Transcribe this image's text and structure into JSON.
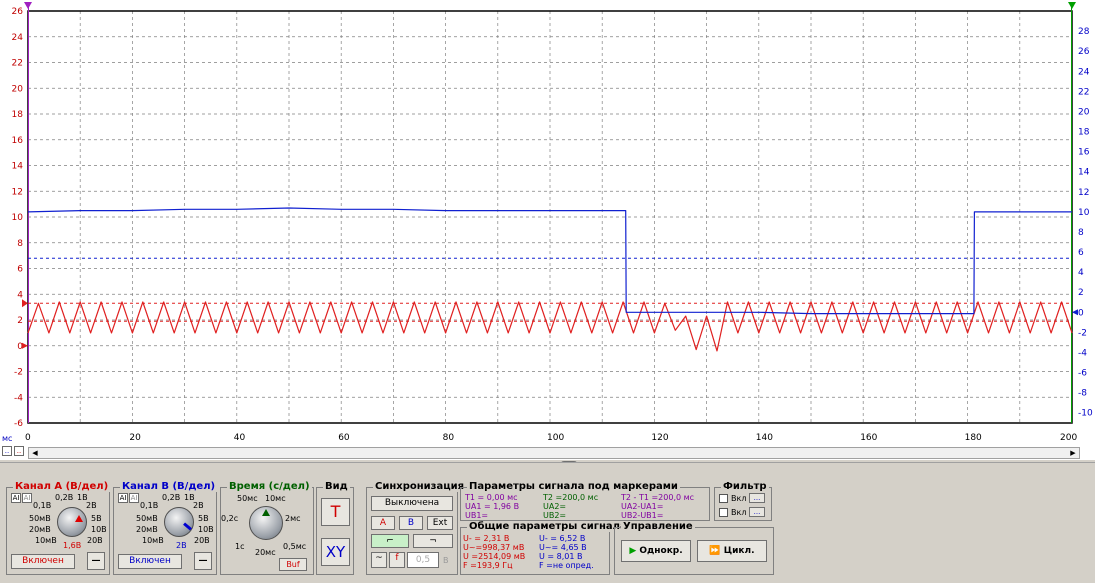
{
  "plot": {
    "y_left_ticks": [
      "26",
      "24",
      "22",
      "20",
      "18",
      "16",
      "14",
      "12",
      "10",
      "8",
      "6",
      "4",
      "2",
      "0",
      "-2",
      "-4",
      "-6"
    ],
    "y_right_ticks": [
      "28",
      "26",
      "24",
      "22",
      "20",
      "18",
      "16",
      "14",
      "12",
      "10",
      "8",
      "6",
      "4",
      "2",
      "0",
      "-2",
      "-4",
      "-6",
      "-8",
      "-10"
    ],
    "x_ticks": [
      "0",
      "20",
      "40",
      "60",
      "80",
      "100",
      "120",
      "140",
      "160",
      "180",
      "200"
    ],
    "x_unit": "мс",
    "colors": {
      "channel_a": "#e02020",
      "channel_b": "#1020d0",
      "grid": "#808080"
    }
  },
  "chart_data": {
    "type": "line",
    "xlim": [
      0,
      200
    ],
    "ylim": [
      -6,
      26
    ],
    "grid": true,
    "series": [
      {
        "name": "Канал A",
        "color": "#e02020",
        "x": [
          0,
          2,
          4,
          6,
          8,
          10,
          12,
          14,
          16,
          18,
          20,
          22,
          24,
          26,
          28,
          30,
          32,
          34,
          36,
          38,
          40,
          42,
          44,
          46,
          48,
          50,
          52,
          54,
          56,
          58,
          60,
          62,
          64,
          66,
          68,
          70,
          72,
          74,
          76,
          78,
          80,
          82,
          84,
          86,
          88,
          90,
          92,
          94,
          96,
          98,
          100,
          102,
          104,
          106,
          108,
          110,
          112,
          114,
          116,
          118,
          120,
          122,
          124,
          126,
          128,
          130,
          132,
          134,
          136,
          138,
          140,
          142,
          144,
          146,
          148,
          150,
          152,
          154,
          156,
          158,
          160,
          162,
          164,
          166,
          168,
          170,
          172,
          174,
          176,
          178,
          180,
          182,
          184,
          186,
          188,
          190,
          192,
          194,
          196,
          198,
          200
        ],
        "y": [
          1.0,
          3.3,
          1.0,
          3.4,
          1.0,
          3.4,
          1.0,
          3.4,
          1.0,
          3.4,
          1.0,
          3.4,
          1.0,
          3.4,
          1.0,
          3.4,
          1.0,
          3.4,
          1.0,
          3.4,
          1.0,
          3.4,
          1.0,
          3.4,
          1.0,
          3.4,
          1.0,
          3.4,
          1.0,
          3.4,
          1.0,
          3.4,
          1.0,
          3.4,
          1.0,
          3.4,
          1.0,
          3.4,
          1.0,
          3.4,
          1.0,
          3.4,
          1.0,
          3.4,
          1.0,
          3.4,
          1.0,
          3.4,
          1.0,
          3.4,
          1.0,
          3.4,
          1.0,
          3.4,
          1.0,
          3.4,
          1.0,
          3.4,
          1.0,
          3.4,
          1.0,
          3.3,
          1.2,
          2.3,
          -0.3,
          2.3,
          -0.4,
          3.4,
          1.0,
          3.4,
          1.0,
          3.4,
          1.0,
          3.4,
          1.0,
          3.4,
          1.0,
          3.4,
          1.0,
          3.4,
          1.0,
          3.4,
          1.0,
          3.4,
          1.0,
          3.4,
          1.0,
          3.4,
          1.0,
          3.4,
          1.0,
          3.4,
          1.0,
          3.4,
          1.0,
          3.4,
          1.0,
          3.4,
          1.0,
          3.4,
          1.0
        ]
      },
      {
        "name": "Канал B",
        "color": "#1020d0",
        "x": [
          0,
          10,
          20,
          30,
          40,
          50,
          60,
          70,
          80,
          90,
          100,
          110,
          114.5,
          114.6,
          116,
          120,
          130,
          140,
          150,
          160,
          170,
          180,
          181.2,
          181.3,
          190,
          200
        ],
        "y": [
          10.4,
          10.5,
          10.5,
          10.6,
          10.6,
          10.7,
          10.6,
          10.6,
          10.5,
          10.5,
          10.5,
          10.5,
          10.5,
          2.6,
          2.6,
          2.6,
          2.6,
          2.6,
          2.5,
          2.5,
          2.5,
          2.5,
          2.5,
          10.4,
          10.4,
          10.4
        ]
      }
    ]
  },
  "panel": {
    "chan_a": {
      "title": "Канал A (В/дел)",
      "labels": [
        "0,1В",
        "0,2В",
        "1В",
        "2В",
        "50мВ",
        "5В",
        "20мВ",
        "10В",
        "10мВ",
        "20В"
      ],
      "current": "1,6В",
      "enable": "Включен",
      "minus": "—"
    },
    "chan_b": {
      "title": "Канал B (В/дел)",
      "labels": [
        "0,1В",
        "0,2В",
        "1В",
        "2В",
        "50мВ",
        "5В",
        "20мВ",
        "10В",
        "10мВ",
        "20В"
      ],
      "current": "2В",
      "enable": "Включен",
      "minus": "—"
    },
    "time": {
      "title": "Время (с/дел)",
      "labels": [
        "50мс",
        "10мс",
        "0,2с",
        "2мс",
        "1с",
        "0,5мс",
        "20мс"
      ],
      "buf": "Buf"
    },
    "view": {
      "title": "Вид",
      "t": "T",
      "xy": "XY"
    },
    "sync": {
      "title": "Синхронизация",
      "state": "Выключена",
      "a": "A",
      "b": "B",
      "ext": "Ext",
      "level": "0,5",
      "level_unit": "В"
    },
    "markers": {
      "title": "Параметры сигнала под маркерами",
      "t1": "T1 = 0,00 мс",
      "ua1": "UA1 = 1,96 В",
      "ub1": "UB1=",
      "t2": "T2 =200,0 мс",
      "ua2": "UA2=",
      "ub2": "UB2=",
      "dt": "T2 - T1 =200,0 мс",
      "dua": "UA2-UA1=",
      "dub": "UB2-UB1="
    },
    "general": {
      "title": "Общие параметры сигнала",
      "a": [
        "U- = 2,31 В",
        "U~=998,37 мВ",
        "U =2514,09 мВ",
        "F =193,9 Гц"
      ],
      "b": [
        "U- = 6,52 В",
        "U~= 4,65 В",
        "U = 8,01 В",
        "F =не опред."
      ]
    },
    "control": {
      "title": "Управление",
      "single": "Однокр.",
      "cycle": "Цикл."
    },
    "filter": {
      "title": "Фильтр",
      "on1": "Вкл",
      "on2": "Вкл",
      "dots": "..."
    }
  }
}
